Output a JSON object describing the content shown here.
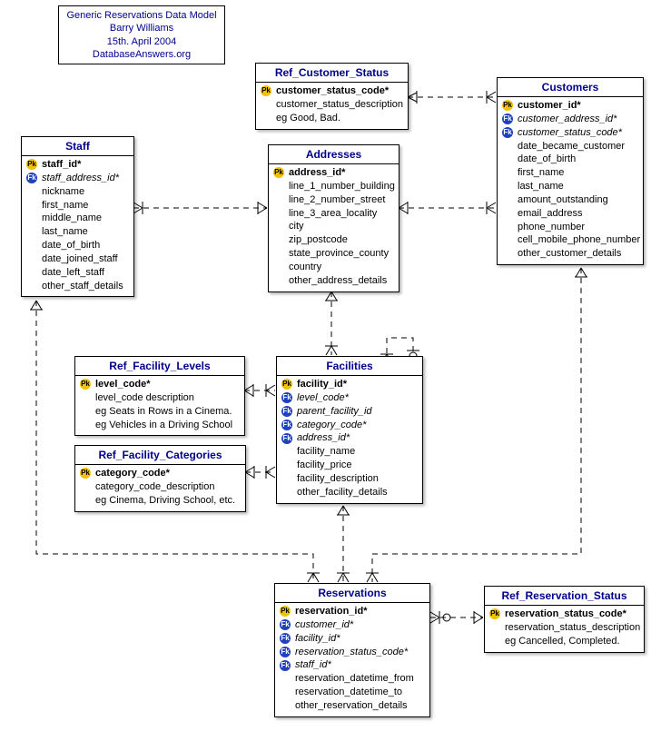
{
  "info": {
    "line1": "Generic Reservations Data Model",
    "line2": "Barry Williams",
    "line3": "15th. April 2004",
    "line4": "DatabaseAnswers.org"
  },
  "entities": {
    "ref_customer_status": {
      "title": "Ref_Customer_Status",
      "attrs": [
        {
          "key": "pk",
          "name": "customer_status_code*",
          "bold": true
        },
        {
          "key": "",
          "name": "customer_status_description"
        },
        {
          "key": "",
          "name": "eg Good, Bad."
        }
      ]
    },
    "customers": {
      "title": "Customers",
      "attrs": [
        {
          "key": "pk",
          "name": "customer_id*",
          "bold": true
        },
        {
          "key": "fk",
          "name": "customer_address_id*",
          "italic": true
        },
        {
          "key": "fk",
          "name": "customer_status_code*",
          "italic": true
        },
        {
          "key": "",
          "name": "date_became_customer"
        },
        {
          "key": "",
          "name": "date_of_birth"
        },
        {
          "key": "",
          "name": "first_name"
        },
        {
          "key": "",
          "name": "last_name"
        },
        {
          "key": "",
          "name": "amount_outstanding"
        },
        {
          "key": "",
          "name": "email_address"
        },
        {
          "key": "",
          "name": "phone_number"
        },
        {
          "key": "",
          "name": "cell_mobile_phone_number"
        },
        {
          "key": "",
          "name": "other_customer_details"
        }
      ]
    },
    "staff": {
      "title": "Staff",
      "attrs": [
        {
          "key": "pk",
          "name": "staff_id*",
          "bold": true
        },
        {
          "key": "fk",
          "name": "staff_address_id*",
          "italic": true
        },
        {
          "key": "",
          "name": "nickname"
        },
        {
          "key": "",
          "name": "first_name"
        },
        {
          "key": "",
          "name": "middle_name"
        },
        {
          "key": "",
          "name": "last_name"
        },
        {
          "key": "",
          "name": "date_of_birth"
        },
        {
          "key": "",
          "name": "date_joined_staff"
        },
        {
          "key": "",
          "name": "date_left_staff"
        },
        {
          "key": "",
          "name": "other_staff_details"
        }
      ]
    },
    "addresses": {
      "title": "Addresses",
      "attrs": [
        {
          "key": "pk",
          "name": "address_id*",
          "bold": true
        },
        {
          "key": "",
          "name": "line_1_number_building"
        },
        {
          "key": "",
          "name": "line_2_number_street"
        },
        {
          "key": "",
          "name": "line_3_area_locality"
        },
        {
          "key": "",
          "name": "city"
        },
        {
          "key": "",
          "name": "zip_postcode"
        },
        {
          "key": "",
          "name": "state_province_county"
        },
        {
          "key": "",
          "name": "country"
        },
        {
          "key": "",
          "name": "other_address_details"
        }
      ]
    },
    "ref_facility_levels": {
      "title": "Ref_Facility_Levels",
      "attrs": [
        {
          "key": "pk",
          "name": "level_code*",
          "bold": true
        },
        {
          "key": "",
          "name": "level_code description"
        },
        {
          "key": "",
          "name": "eg Seats in Rows in a Cinema."
        },
        {
          "key": "",
          "name": "eg Vehicles in a Driving School"
        }
      ]
    },
    "facilities": {
      "title": "Facilities",
      "attrs": [
        {
          "key": "pk",
          "name": "facility_id*",
          "bold": true
        },
        {
          "key": "fk",
          "name": "level_code*",
          "italic": true
        },
        {
          "key": "fk",
          "name": "parent_facility_id",
          "italic": true
        },
        {
          "key": "fk",
          "name": "category_code*",
          "italic": true
        },
        {
          "key": "fk",
          "name": "address_id*",
          "italic": true
        },
        {
          "key": "",
          "name": "facility_name"
        },
        {
          "key": "",
          "name": "facility_price"
        },
        {
          "key": "",
          "name": "facility_description"
        },
        {
          "key": "",
          "name": "other_facility_details"
        }
      ]
    },
    "ref_facility_categories": {
      "title": "Ref_Facility_Categories",
      "attrs": [
        {
          "key": "pk",
          "name": "category_code*",
          "bold": true
        },
        {
          "key": "",
          "name": "category_code_description"
        },
        {
          "key": "",
          "name": "eg Cinema, Driving School, etc."
        }
      ]
    },
    "reservations": {
      "title": "Reservations",
      "attrs": [
        {
          "key": "pk",
          "name": "reservation_id*",
          "bold": true
        },
        {
          "key": "fk",
          "name": "customer_id*",
          "italic": true
        },
        {
          "key": "fk",
          "name": "facility_id*",
          "italic": true
        },
        {
          "key": "fk",
          "name": "reservation_status_code*",
          "italic": true
        },
        {
          "key": "fk",
          "name": "staff_id*",
          "italic": true
        },
        {
          "key": "",
          "name": "reservation_datetime_from"
        },
        {
          "key": "",
          "name": "reservation_datetime_to"
        },
        {
          "key": "",
          "name": "other_reservation_details"
        }
      ]
    },
    "ref_reservation_status": {
      "title": "Ref_Reservation_Status",
      "attrs": [
        {
          "key": "pk",
          "name": "reservation_status_code*",
          "bold": true
        },
        {
          "key": "",
          "name": "reservation_status_description"
        },
        {
          "key": "",
          "name": "eg Cancelled, Completed."
        }
      ]
    }
  },
  "relationships": [
    {
      "from": "ref_customer_status",
      "to": "customers",
      "via": "customer_status_code"
    },
    {
      "from": "addresses",
      "to": "customers",
      "via": "customer_address_id"
    },
    {
      "from": "addresses",
      "to": "staff",
      "via": "staff_address_id"
    },
    {
      "from": "addresses",
      "to": "facilities",
      "via": "address_id"
    },
    {
      "from": "ref_facility_levels",
      "to": "facilities",
      "via": "level_code"
    },
    {
      "from": "ref_facility_categories",
      "to": "facilities",
      "via": "category_code"
    },
    {
      "from": "facilities",
      "to": "facilities",
      "via": "parent_facility_id",
      "self": true
    },
    {
      "from": "facilities",
      "to": "reservations",
      "via": "facility_id"
    },
    {
      "from": "staff",
      "to": "reservations",
      "via": "staff_id"
    },
    {
      "from": "customers",
      "to": "reservations",
      "via": "customer_id"
    },
    {
      "from": "ref_reservation_status",
      "to": "reservations",
      "via": "reservation_status_code"
    }
  ]
}
